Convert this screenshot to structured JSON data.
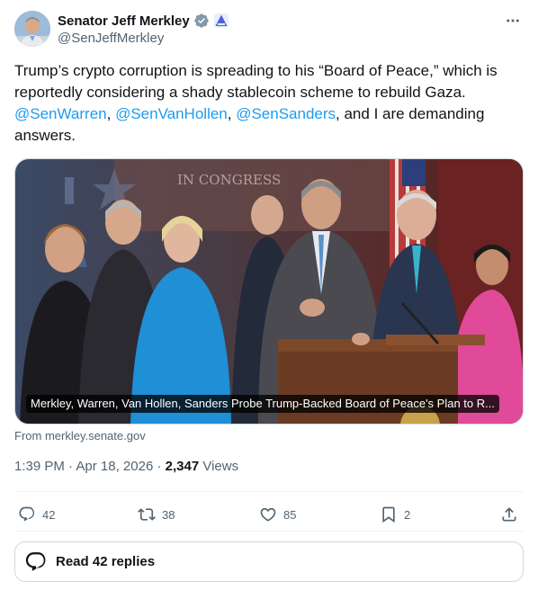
{
  "author": {
    "display_name": "Senator Jeff Merkley",
    "handle": "@SenJeffMerkley"
  },
  "tweet": {
    "text_1": "Trump’s crypto corruption is spreading to his “Board of Peace,” which is reportedly considering a shady stablecoin scheme to rebuild Gaza. ",
    "mention_1": "@SenWarren",
    "sep_1": ", ",
    "mention_2": "@SenVanHollen",
    "sep_2": ", ",
    "mention_3": "@SenSanders",
    "text_2": ", and I are demanding answers."
  },
  "card": {
    "caption": "Merkley, Warren, Van Hollen, Sanders Probe Trump-Backed Board of Peace's Plan to R...",
    "source": "From merkley.senate.gov",
    "photo_backdrop_text": "IN CONGRESS"
  },
  "meta": {
    "time": "1:39 PM",
    "sep": " · ",
    "date": "Apr 18, 2026",
    "sep2": " · ",
    "views_count": "2,347",
    "views_label": " Views"
  },
  "actions": {
    "reply_count": "42",
    "repost_count": "38",
    "like_count": "85",
    "bookmark_count": "2"
  },
  "replies_button": {
    "label": "Read 42 replies"
  },
  "colors": {
    "link": "#1d9bf0",
    "verified": "#829aab",
    "secondary_text": "#536471"
  }
}
